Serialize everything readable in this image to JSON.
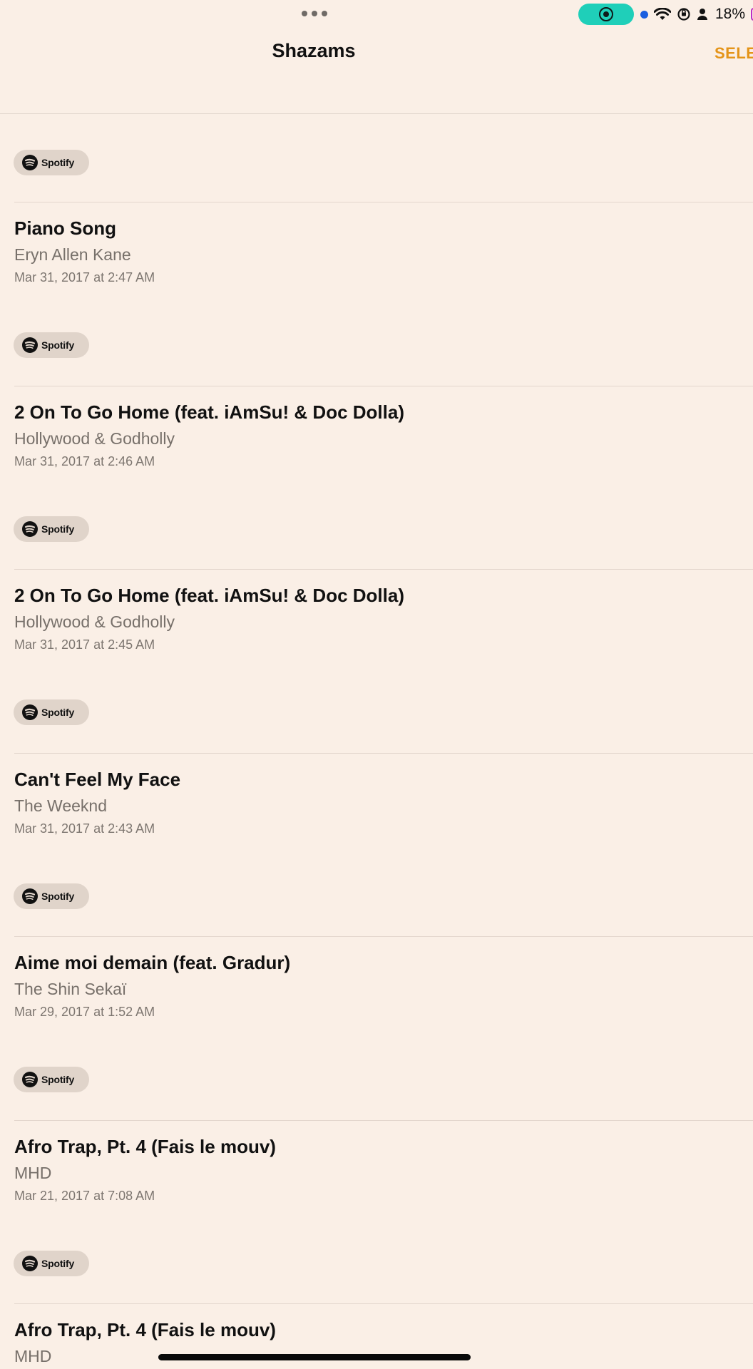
{
  "status_bar": {
    "battery_percent": "18%",
    "record_indicator": "screen-recording",
    "accent_record": "#1fcfb9",
    "battery_color": "#c02bc5"
  },
  "header": {
    "title": "Shazams",
    "select_label": "SELE",
    "accent": "#e49419"
  },
  "spotify_label": "Spotify",
  "songs": [
    {
      "title": "Piano Song",
      "artist": "Eryn Allen Kane",
      "date": "Mar 31, 2017 at 2:47 AM"
    },
    {
      "title": "2 On To Go Home (feat. iAmSu! & Doc Dolla)",
      "artist": "Hollywood & Godholly",
      "date": "Mar 31, 2017 at 2:46 AM"
    },
    {
      "title": "2 On To Go Home (feat. iAmSu! & Doc Dolla)",
      "artist": "Hollywood & Godholly",
      "date": "Mar 31, 2017 at 2:45 AM"
    },
    {
      "title": "Can't Feel My Face",
      "artist": "The Weeknd",
      "date": "Mar 31, 2017 at 2:43 AM"
    },
    {
      "title": "Aime moi demain (feat. Gradur)",
      "artist": "The Shin Sekaï",
      "date": "Mar 29, 2017 at 1:52 AM"
    },
    {
      "title": "Afro Trap, Pt. 4 (Fais le mouv)",
      "artist": "MHD",
      "date": "Mar 21, 2017 at 7:08 AM"
    },
    {
      "title": "Afro Trap, Pt. 4 (Fais le mouv)",
      "artist": "MHD",
      "date": ""
    }
  ]
}
